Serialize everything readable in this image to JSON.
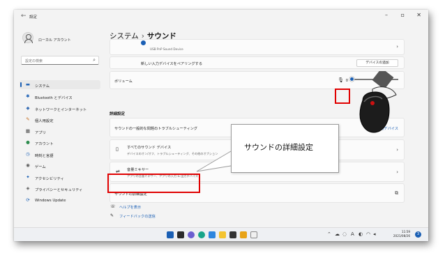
{
  "window": {
    "title": "設定",
    "minimize": "–",
    "maximize": "▫",
    "close": "✕"
  },
  "sidebar": {
    "account_name": "ローカル アカウント",
    "search_placeholder": "設定の検索",
    "items": [
      {
        "label": "システム",
        "icon": "monitor-icon",
        "glyph": "▬",
        "color": "#1a5fb4"
      },
      {
        "label": "Bluetooth とデバイス",
        "icon": "bluetooth-icon",
        "glyph": "✱",
        "color": "#1a5fb4"
      },
      {
        "label": "ネットワークとインターネット",
        "icon": "network-icon",
        "glyph": "◆",
        "color": "#3a6fb5"
      },
      {
        "label": "個人用設定",
        "icon": "pen-icon",
        "glyph": "✎",
        "color": "#c46a1b"
      },
      {
        "label": "アプリ",
        "icon": "apps-icon",
        "glyph": "▦",
        "color": "#444"
      },
      {
        "label": "アカウント",
        "icon": "person-icon",
        "glyph": "●",
        "color": "#2d8c4e"
      },
      {
        "label": "時刻と言語",
        "icon": "clock-icon",
        "glyph": "◷",
        "color": "#1a5fb4"
      },
      {
        "label": "ゲーム",
        "icon": "gamepad-icon",
        "glyph": "◉",
        "color": "#555"
      },
      {
        "label": "アクセシビリティ",
        "icon": "accessibility-icon",
        "glyph": "✦",
        "color": "#1a5fb4"
      },
      {
        "label": "プライバシーとセキュリティ",
        "icon": "shield-icon",
        "glyph": "◈",
        "color": "#555"
      },
      {
        "label": "Windows Update",
        "icon": "update-icon",
        "glyph": "⟳",
        "color": "#1a5fb4"
      }
    ]
  },
  "main": {
    "breadcrumb_parent": "システム",
    "breadcrumb_separator": "›",
    "breadcrumb_current": "サウンド",
    "device_sub": "USB PnP Sound Device",
    "pair_label": "新しい入力デバイスをペアリングする",
    "add_device_button": "デバイスの追加",
    "volume_label": "ボリューム",
    "volume_value": "0",
    "volume_level": 0,
    "section_advanced": "詳細設定",
    "troubleshoot_label": "サウンドの一般的な問題のトラブルシューティング",
    "input_devices_link": "入力デバイス",
    "all_devices_label": "すべてのサウンド デバイス",
    "all_devices_sub": "デバイスのオン/オフ、トラブルシューティング、その他のオプション",
    "mixer_label": "音量ミキサー",
    "mixer_sub": "アプリの音量ミキサー、アプリの入力 & 出力デバイス",
    "more_sound_label": "サウンドの詳細設定",
    "help_label": "ヘルプを表示",
    "feedback_label": "フィードバックの送信"
  },
  "callout": {
    "text": "サウンドの詳細設定"
  },
  "taskbar": {
    "time": "11:59",
    "date": "2021/08/26",
    "notification_count": "3",
    "tray_text": "A"
  }
}
